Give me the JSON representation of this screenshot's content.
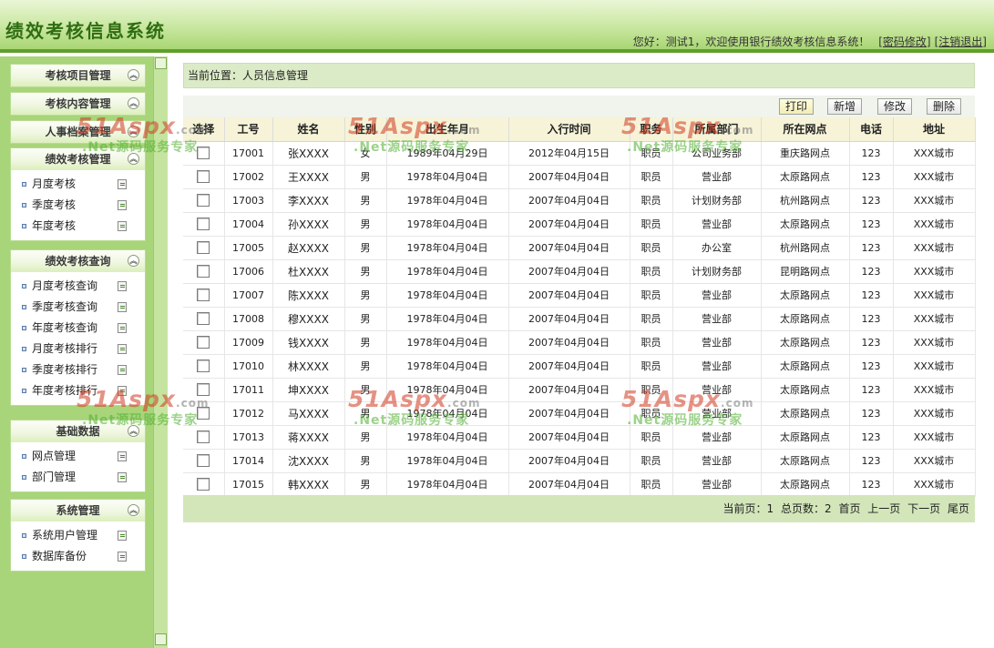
{
  "header": {
    "title": "绩效考核信息系统",
    "greeting": "您好：测试1，欢迎使用银行绩效考核信息系统！",
    "change_password": "[密码修改]",
    "logout": "[注销退出]"
  },
  "sidebar": {
    "panels": [
      {
        "title": "考核项目管理",
        "items": []
      },
      {
        "title": "考核内容管理",
        "items": []
      },
      {
        "title": "人事档案管理",
        "items": []
      },
      {
        "title": "绩效考核管理",
        "items": [
          "月度考核",
          "季度考核",
          "年度考核"
        ]
      },
      {
        "title": "绩效考核查询",
        "items": [
          "月度考核查询",
          "季度考核查询",
          "年度考核查询",
          "月度考核排行",
          "季度考核排行",
          "年度考核排行"
        ]
      },
      {
        "title": "基础数据",
        "items": [
          "网点管理",
          "部门管理"
        ]
      },
      {
        "title": "系统管理",
        "items": [
          "系统用户管理",
          "数据库备份"
        ]
      }
    ]
  },
  "location": "当前位置：人员信息管理",
  "toolbar": {
    "print": "打印",
    "add": "新增",
    "edit": "修改",
    "delete": "删除"
  },
  "table": {
    "columns": [
      "选择",
      "工号",
      "姓名",
      "性别",
      "出生年月",
      "入行时间",
      "职务",
      "所属部门",
      "所在网点",
      "电话",
      "地址"
    ],
    "rows": [
      [
        "17001",
        "张XXXX",
        "女",
        "1989年04月29日",
        "2012年04月15日",
        "职员",
        "公司业务部",
        "重庆路网点",
        "123",
        "XXX城市"
      ],
      [
        "17002",
        "王XXXX",
        "男",
        "1978年04月04日",
        "2007年04月04日",
        "职员",
        "营业部",
        "太原路网点",
        "123",
        "XXX城市"
      ],
      [
        "17003",
        "李XXXX",
        "男",
        "1978年04月04日",
        "2007年04月04日",
        "职员",
        "计划财务部",
        "杭州路网点",
        "123",
        "XXX城市"
      ],
      [
        "17004",
        "孙XXXX",
        "男",
        "1978年04月04日",
        "2007年04月04日",
        "职员",
        "营业部",
        "太原路网点",
        "123",
        "XXX城市"
      ],
      [
        "17005",
        "赵XXXX",
        "男",
        "1978年04月04日",
        "2007年04月04日",
        "职员",
        "办公室",
        "杭州路网点",
        "123",
        "XXX城市"
      ],
      [
        "17006",
        "杜XXXX",
        "男",
        "1978年04月04日",
        "2007年04月04日",
        "职员",
        "计划财务部",
        "昆明路网点",
        "123",
        "XXX城市"
      ],
      [
        "17007",
        "陈XXXX",
        "男",
        "1978年04月04日",
        "2007年04月04日",
        "职员",
        "营业部",
        "太原路网点",
        "123",
        "XXX城市"
      ],
      [
        "17008",
        "穆XXXX",
        "男",
        "1978年04月04日",
        "2007年04月04日",
        "职员",
        "营业部",
        "太原路网点",
        "123",
        "XXX城市"
      ],
      [
        "17009",
        "钱XXXX",
        "男",
        "1978年04月04日",
        "2007年04月04日",
        "职员",
        "营业部",
        "太原路网点",
        "123",
        "XXX城市"
      ],
      [
        "17010",
        "林XXXX",
        "男",
        "1978年04月04日",
        "2007年04月04日",
        "职员",
        "营业部",
        "太原路网点",
        "123",
        "XXX城市"
      ],
      [
        "17011",
        "坤XXXX",
        "男",
        "1978年04月04日",
        "2007年04月04日",
        "职员",
        "营业部",
        "太原路网点",
        "123",
        "XXX城市"
      ],
      [
        "17012",
        "马XXXX",
        "男",
        "1978年04月04日",
        "2007年04月04日",
        "职员",
        "营业部",
        "太原路网点",
        "123",
        "XXX城市"
      ],
      [
        "17013",
        "蒋XXXX",
        "男",
        "1978年04月04日",
        "2007年04月04日",
        "职员",
        "营业部",
        "太原路网点",
        "123",
        "XXX城市"
      ],
      [
        "17014",
        "沈XXXX",
        "男",
        "1978年04月04日",
        "2007年04月04日",
        "职员",
        "营业部",
        "太原路网点",
        "123",
        "XXX城市"
      ],
      [
        "17015",
        "韩XXXX",
        "男",
        "1978年04月04日",
        "2007年04月04日",
        "职员",
        "营业部",
        "太原路网点",
        "123",
        "XXX城市"
      ]
    ]
  },
  "pager": {
    "current": "当前页：1",
    "total": "总页数：2",
    "first": "首页",
    "prev": "上一页",
    "next": "下一页",
    "last": "尾页"
  },
  "watermark": {
    "logo": "51Aspx",
    "logo_suffix": ".com",
    "tagline": ".Net源码服务专家"
  }
}
